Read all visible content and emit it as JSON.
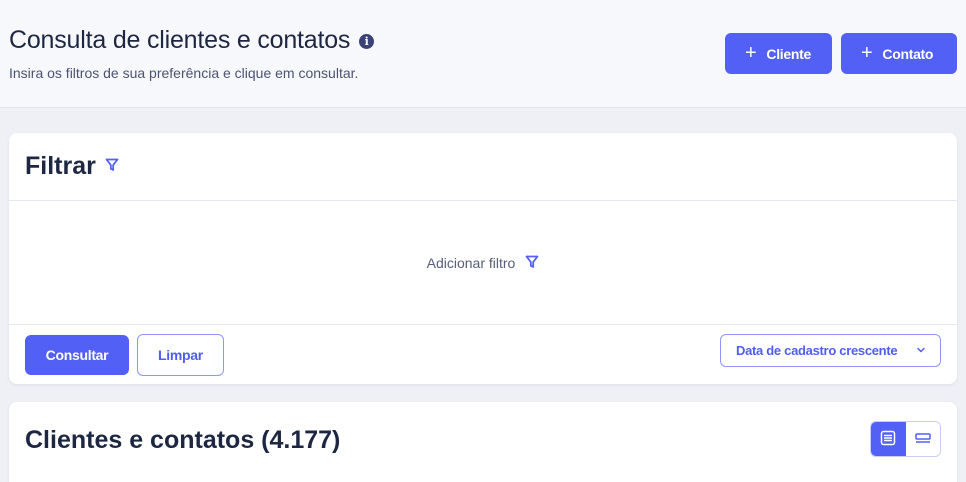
{
  "header": {
    "title": "Consulta de clientes e contatos",
    "info_icon": "i",
    "subtitle": "Insira os filtros de sua preferência e clique em consultar.",
    "actions": [
      {
        "label": "Cliente",
        "icon": "plus-icon"
      },
      {
        "label": "Contato",
        "icon": "plus-icon"
      }
    ]
  },
  "filter": {
    "title": "Filtrar",
    "add_filter_label": "Adicionar filtro",
    "consultar_label": "Consultar",
    "limpar_label": "Limpar",
    "sort_value": "Data de cadastro crescente"
  },
  "results": {
    "title": "Clientes e contatos (4.177)",
    "view_modes": [
      "list-view-icon",
      "compact-view-icon"
    ],
    "active_view": "list-view-icon"
  },
  "colors": {
    "accent": "#5260f5",
    "text": "#1e2742",
    "background": "#eef0f5"
  }
}
